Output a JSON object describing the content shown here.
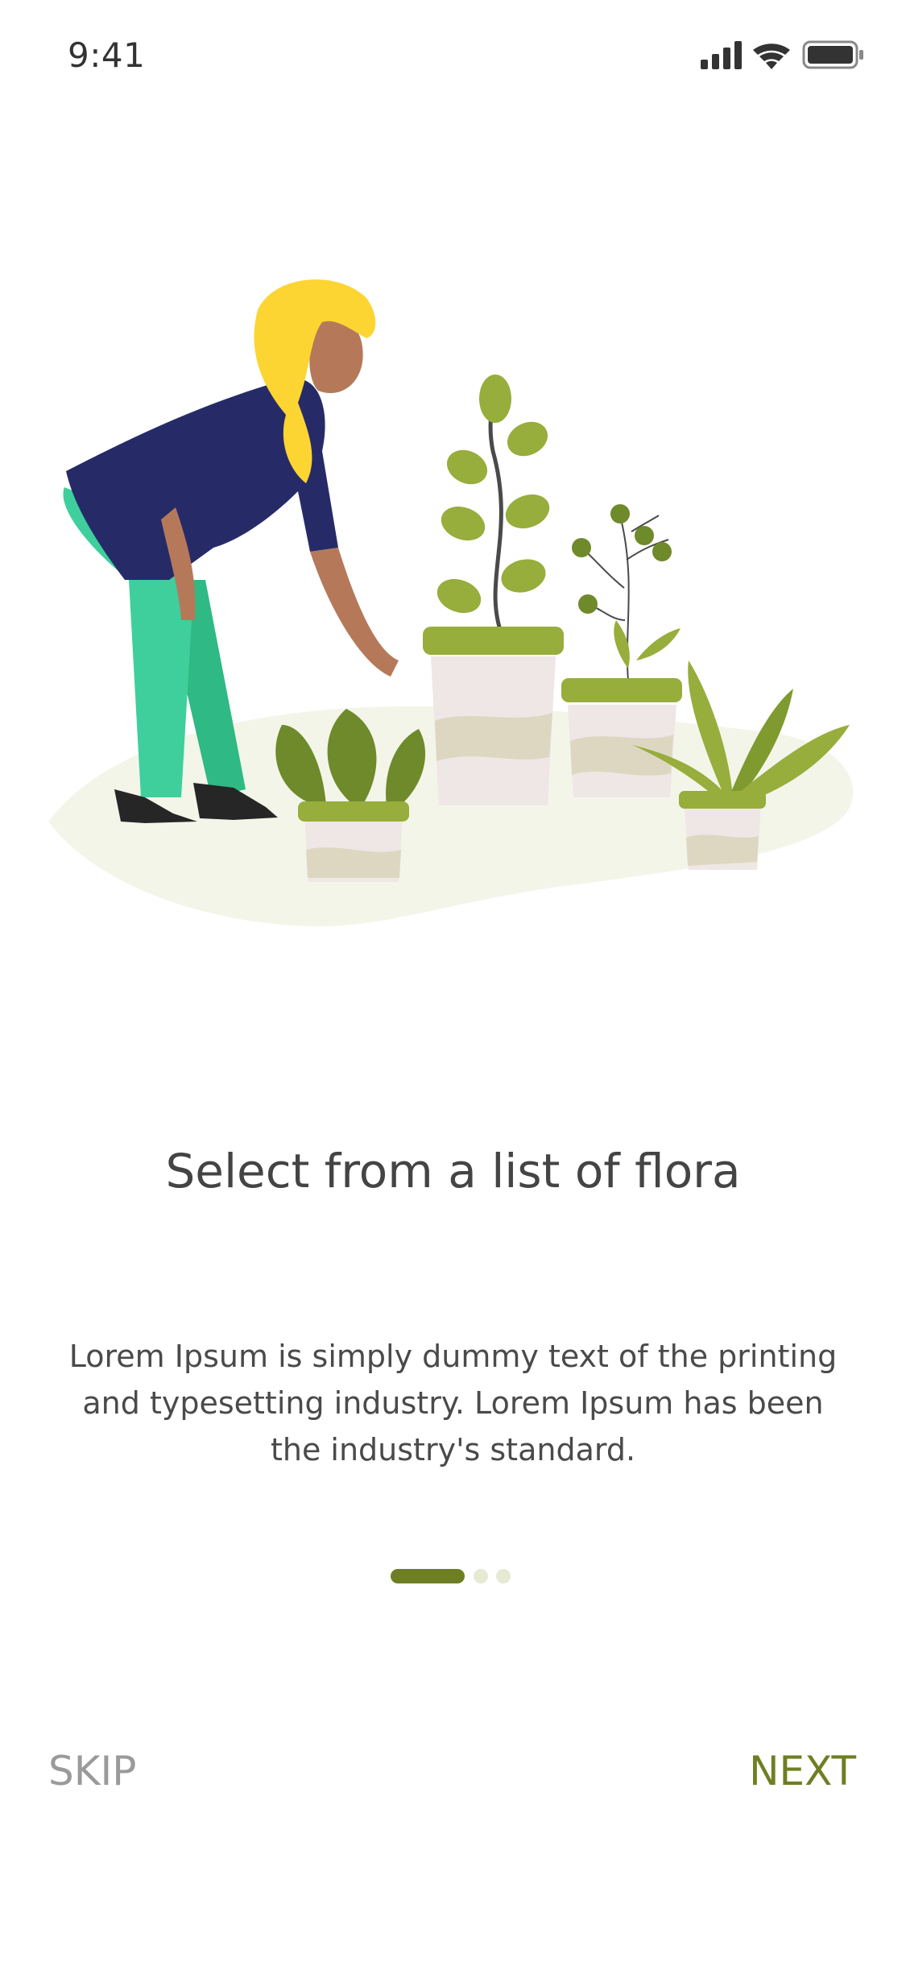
{
  "status_bar": {
    "time": "9:41",
    "icons": [
      "cellular-signal-icon",
      "wifi-icon",
      "battery-icon"
    ]
  },
  "illustration": {
    "subject": "woman-tending-potted-plants-illustration"
  },
  "onboarding": {
    "title": "Select from a list of flora",
    "description": "Lorem Ipsum is simply dummy text of the printing and typesetting industry. Lorem Ipsum has been the industry's standard.",
    "page_indicator": {
      "current": 1,
      "total": 3
    }
  },
  "actions": {
    "skip_label": "SKIP",
    "next_label": "NEXT"
  },
  "colors": {
    "accent": "#6e7f23",
    "dot_inactive": "#e6ead3",
    "title_text": "#444444",
    "skip_text": "#9a9a9a"
  }
}
